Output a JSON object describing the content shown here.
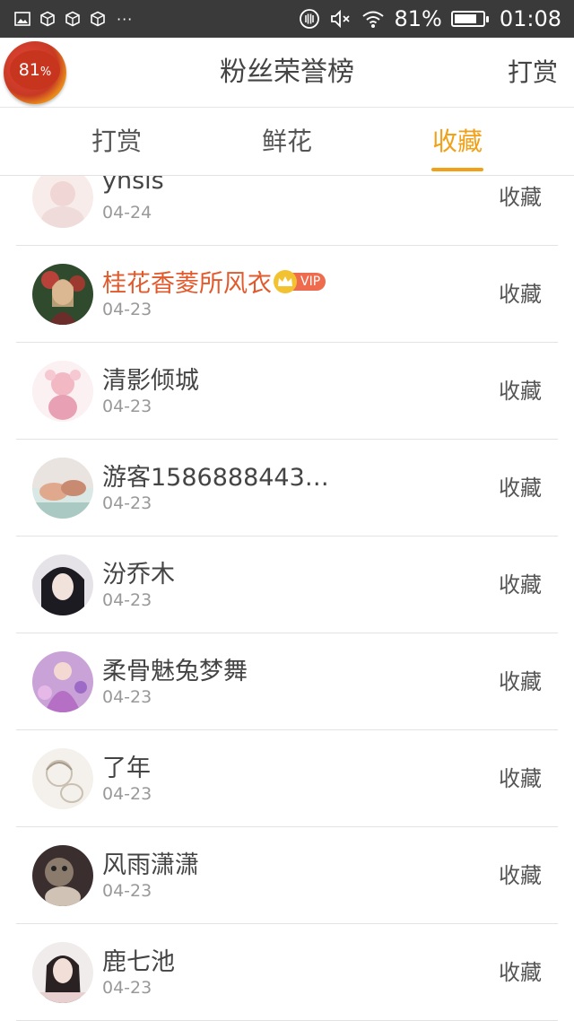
{
  "status_bar": {
    "icons": [
      "gallery-icon",
      "package-icon",
      "package-icon",
      "package-icon"
    ],
    "overflow": "···",
    "right_icons": [
      "vibrate-icon",
      "mute-icon",
      "wifi-icon"
    ],
    "battery_percent": "81%",
    "battery_level": 0.81,
    "time": "01:08"
  },
  "header": {
    "badge_value": "81",
    "badge_unit": "%",
    "title": "粉丝荣誉榜",
    "action": "打赏"
  },
  "tabs": [
    {
      "label": "打赏",
      "active": false
    },
    {
      "label": "鲜花",
      "active": false
    },
    {
      "label": "收藏",
      "active": true
    }
  ],
  "accent_color": "#f1a117",
  "fans": [
    {
      "name": "yhsis",
      "date": "04-24",
      "action": "收藏",
      "vip": false
    },
    {
      "name": "桂花香菱所风衣",
      "date": "04-23",
      "action": "收藏",
      "vip": true,
      "vip_label": "VIP"
    },
    {
      "name": "清影倾城",
      "date": "04-23",
      "action": "收藏",
      "vip": false
    },
    {
      "name": "游客1586888443…",
      "date": "04-23",
      "action": "收藏",
      "vip": false
    },
    {
      "name": "汾乔木",
      "date": "04-23",
      "action": "收藏",
      "vip": false
    },
    {
      "name": "柔骨魅兔梦舞",
      "date": "04-23",
      "action": "收藏",
      "vip": false
    },
    {
      "name": "了年",
      "date": "04-23",
      "action": "收藏",
      "vip": false
    },
    {
      "name": "风雨潇潇",
      "date": "04-23",
      "action": "收藏",
      "vip": false
    },
    {
      "name": "鹿七池",
      "date": "04-23",
      "action": "收藏",
      "vip": false
    }
  ]
}
